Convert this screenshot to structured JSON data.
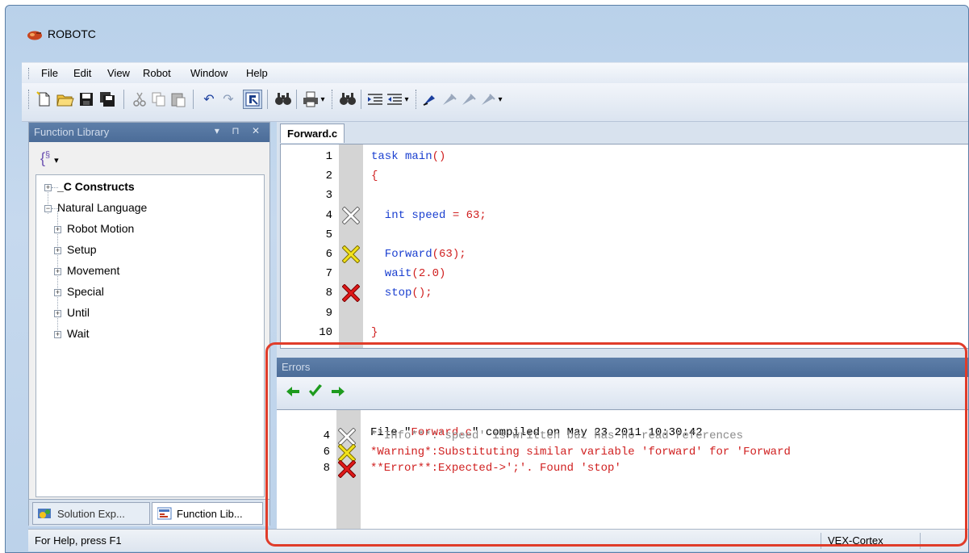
{
  "window": {
    "title": "ROBOTC"
  },
  "menu": [
    "File",
    "Edit",
    "View",
    "Robot",
    "Window",
    "Help"
  ],
  "toolbar": {
    "icons": [
      "new-file-icon",
      "open-folder-icon",
      "save-icon",
      "save-all-icon",
      "cut-icon",
      "copy-icon",
      "paste-icon",
      "undo-icon",
      "redo-icon",
      "compile-icon",
      "find-icon",
      "print-icon",
      "find-in-files-icon",
      "indent-icon",
      "outdent-icon",
      "breakpoint-icon",
      "bookmark-icon",
      "next-bookmark-icon",
      "clear-bookmarks-icon"
    ]
  },
  "function_library": {
    "header": "Function Library",
    "tree": [
      {
        "label": "_C Constructs",
        "bold": true,
        "level": 0,
        "expander": "+"
      },
      {
        "label": "Natural Language",
        "bold": false,
        "level": 0,
        "expander": "-"
      },
      {
        "label": "Robot Motion",
        "bold": false,
        "level": 1,
        "expander": "+"
      },
      {
        "label": "Setup",
        "bold": false,
        "level": 1,
        "expander": "+"
      },
      {
        "label": "Movement",
        "bold": false,
        "level": 1,
        "expander": "+"
      },
      {
        "label": "Special",
        "bold": false,
        "level": 1,
        "expander": "+"
      },
      {
        "label": "Until",
        "bold": false,
        "level": 1,
        "expander": "+"
      },
      {
        "label": "Wait",
        "bold": false,
        "level": 1,
        "expander": "+"
      }
    ],
    "tabs": {
      "solution": "Solution Exp...",
      "function": "Function Lib..."
    }
  },
  "editor": {
    "tab": "Forward.c",
    "lines": [
      {
        "num": "1",
        "marker": "",
        "tokens": [
          [
            "task main",
            "#1a3fd0"
          ],
          [
            "()",
            "#d02020"
          ]
        ]
      },
      {
        "num": "2",
        "marker": "",
        "tokens": [
          [
            "{",
            "#d02020"
          ]
        ]
      },
      {
        "num": "3",
        "marker": "",
        "tokens": []
      },
      {
        "num": "4",
        "marker": "info",
        "tokens": [
          [
            "  int speed ",
            "#1a3fd0"
          ],
          [
            "= 63;",
            "#d02020"
          ]
        ]
      },
      {
        "num": "5",
        "marker": "",
        "tokens": []
      },
      {
        "num": "6",
        "marker": "warning",
        "tokens": [
          [
            "  Forward",
            "#1a3fd0"
          ],
          [
            "(63);",
            "#d02020"
          ]
        ]
      },
      {
        "num": "7",
        "marker": "",
        "tokens": [
          [
            "  wait",
            "#1a3fd0"
          ],
          [
            "(2.0)",
            "#d02020"
          ]
        ]
      },
      {
        "num": "8",
        "marker": "error",
        "tokens": [
          [
            "  stop",
            "#1a3fd0"
          ],
          [
            "();",
            "#d02020"
          ]
        ]
      },
      {
        "num": "9",
        "marker": "",
        "tokens": []
      },
      {
        "num": "10",
        "marker": "",
        "tokens": [
          [
            "}",
            "#d02020"
          ]
        ]
      }
    ]
  },
  "errors": {
    "header": "Errors",
    "tools": [
      "previous-arrow-icon",
      "check-icon",
      "next-arrow-icon"
    ],
    "file_prefix": "File \"",
    "file_name": "Forward.c",
    "file_suffix": "\" compiled on May 23 2011 10:30:42",
    "messages": [
      {
        "line": "4",
        "type": "info",
        "text": "**Info***:'speed' is written but has no read references",
        "color": "#8a8a8a"
      },
      {
        "line": "6",
        "type": "warning",
        "text": "*Warning*:Substituting similar variable 'forward' for 'Forward",
        "color": "#d02020"
      },
      {
        "line": "8",
        "type": "error",
        "text": "**Error**:Expected->';'. Found 'stop'",
        "color": "#d02020"
      }
    ]
  },
  "statusbar": {
    "help": "For Help, press F1",
    "target": "VEX-Cortex"
  },
  "colors": {
    "highlight": "#e03c2a",
    "info_mark": "#ffffff",
    "warning_mark": "#f2e21a",
    "error_mark": "#e01818"
  }
}
